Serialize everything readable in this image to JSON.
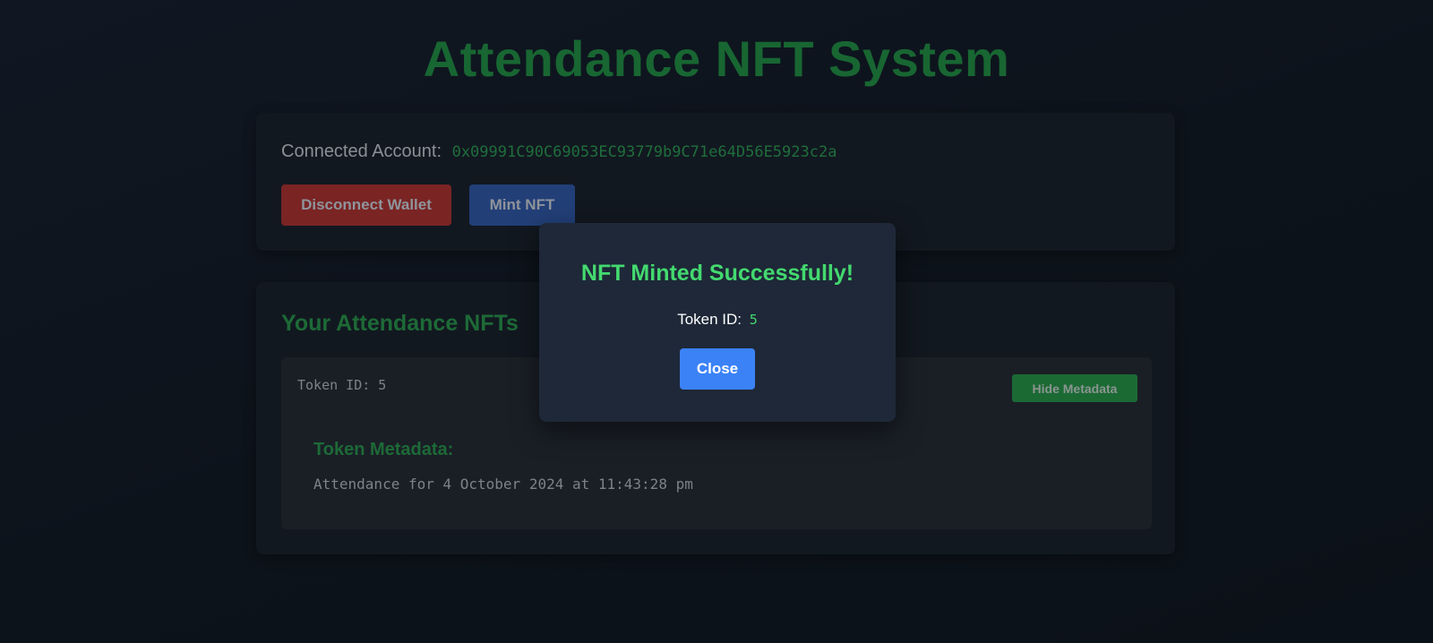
{
  "app": {
    "title": "Attendance NFT System"
  },
  "account": {
    "label": "Connected Account:",
    "address": "0x09991C90C69053EC93779b9C71e64D56E5923c2a",
    "disconnect_label": "Disconnect Wallet",
    "mint_label": "Mint NFT"
  },
  "nfts": {
    "heading": "Your Attendance NFTs",
    "items": [
      {
        "token_label": "Token ID: 5",
        "hide_label": "Hide Metadata",
        "metadata_heading": "Token Metadata:",
        "metadata_text": "Attendance for 4 October 2024 at 11:43:28 pm"
      }
    ]
  },
  "modal": {
    "title": "NFT Minted Successfully!",
    "token_label": "Token ID:",
    "token_value": "5",
    "close_label": "Close"
  },
  "colors": {
    "title_green": "#186632",
    "success_green": "#43d96f",
    "disconnect_red": "#7a2424",
    "mint_blue": "#223f78",
    "close_blue": "#3b82f6",
    "modal_bg": "#1e2838"
  }
}
